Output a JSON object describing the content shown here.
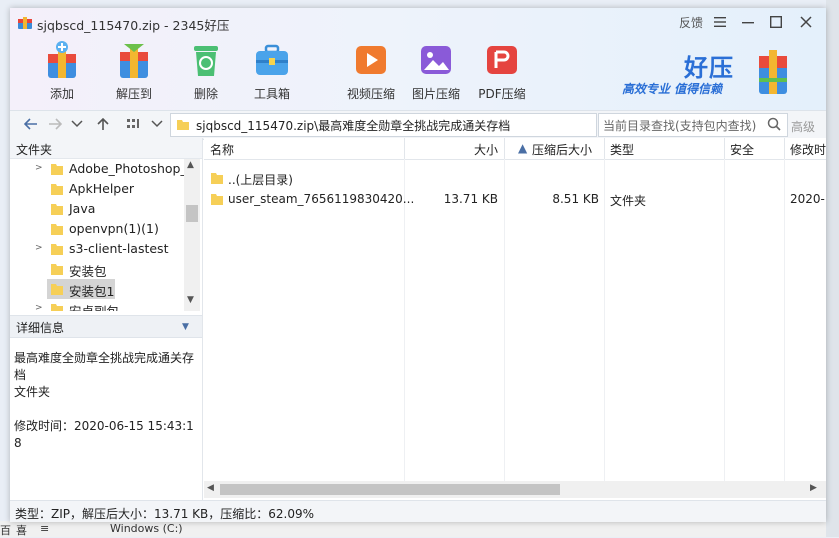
{
  "window": {
    "title": "sjqbscd_115470.zip - 2345好压",
    "feedback_label": "反馈"
  },
  "toolbar": {
    "tools": [
      {
        "label": "添加",
        "icon": "add-icon"
      },
      {
        "label": "解压到",
        "icon": "extract-icon"
      },
      {
        "label": "删除",
        "icon": "delete-icon"
      },
      {
        "label": "工具箱",
        "icon": "toolbox-icon"
      },
      {
        "label": "视频压缩",
        "icon": "video-compress-icon"
      },
      {
        "label": "图片压缩",
        "icon": "image-compress-icon"
      },
      {
        "label": "PDF压缩",
        "icon": "pdf-compress-icon"
      }
    ]
  },
  "brand": {
    "name": "好压",
    "slogan": "高效专业  值得信赖"
  },
  "navbar": {
    "path": "sjqbscd_115470.zip\\最高难度全勋章全挑战完成通关存档",
    "search_placeholder": "当前目录查找(支持包内查找)",
    "advanced_label": "高级"
  },
  "folder_tree": {
    "header": "文件夹",
    "items": [
      {
        "label": "Adobe_Photoshop_",
        "has_children": true
      },
      {
        "label": "ApkHelper",
        "has_children": false
      },
      {
        "label": "Java",
        "has_children": false
      },
      {
        "label": "openvpn(1)(1)",
        "has_children": false
      },
      {
        "label": "s3-client-lastest",
        "has_children": true
      },
      {
        "label": "安装包",
        "has_children": false
      },
      {
        "label": "安装包1",
        "has_children": false,
        "selected": true
      },
      {
        "label": "安卓副包",
        "has_children": true
      }
    ]
  },
  "details": {
    "header": "详细信息",
    "name": "最高难度全勋章全挑战完成通关存档",
    "type": "文件夹",
    "modified": "修改时间：2020-06-15 15:43:18"
  },
  "file_list": {
    "columns": {
      "name": "名称",
      "size": "大小",
      "compressed": "压缩后大小",
      "type": "类型",
      "security": "安全",
      "modified": "修改时"
    },
    "rows": [
      {
        "name": "..(上层目录)",
        "size": "",
        "compressed": "",
        "type": "",
        "modified": ""
      },
      {
        "name": "user_steam_7656119830420...",
        "size": "13.71 KB",
        "compressed": "8.51 KB",
        "type": "文件夹",
        "modified": "2020-"
      }
    ]
  },
  "status": {
    "text": "类型：ZIP，解压后大小：13.71 KB，压缩比：62.09%"
  },
  "background_strip": {
    "items": [
      "百",
      "喜",
      "≡",
      "Windows (C:)"
    ]
  },
  "colors": {
    "brand_blue": "#2a6fd6",
    "folder_yellow": "#f6cf57",
    "selection_gray": "#d4d4d4"
  }
}
